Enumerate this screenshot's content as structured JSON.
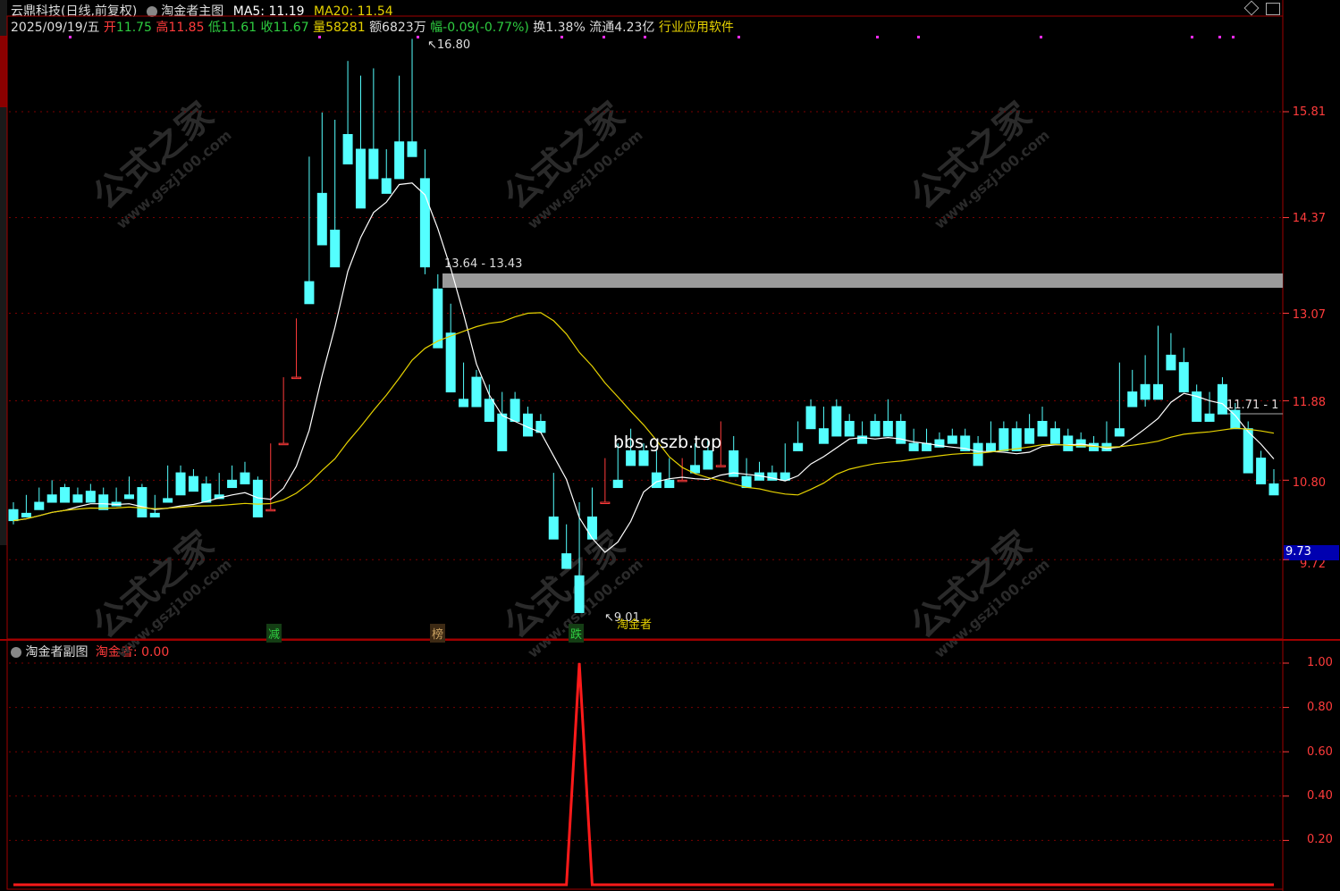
{
  "header": {
    "stock_name": "云鼎科技",
    "period_info": "(日线,前复权)",
    "indicator_name": "淘金者主图",
    "ma5_label": "MA5: 11.19",
    "ma20_label": "MA20: 11.54",
    "date": "2025/09/19/五",
    "open_label": "开",
    "open_val": "11.75",
    "high_label": "高",
    "high_val": "11.85",
    "low_label": "低",
    "low_val": "11.61",
    "close_label": "收",
    "close_val": "11.67",
    "volume_label": "量",
    "volume_val": "58281",
    "amount_label": "额6823万",
    "change_label": "幅",
    "change_val": "-0.09(-0.77%)",
    "turnover_label": "换1.38%",
    "float_label": "流通4.23亿",
    "industry": "行业应用软件"
  },
  "main_chart": {
    "y_ticks": [
      "15.81",
      "14.37",
      "13.07",
      "11.88",
      "10.80",
      "9.72"
    ],
    "current_price_tag": "9.73",
    "high_marker": "16.80",
    "low_marker": "9.01",
    "resistance_label": "13.64 - 13.43",
    "right_band_label": "11.71 - 1",
    "watermark_site": "bbs.gszb.top",
    "watermark_brand": "公式之家",
    "watermark_url": "www.gszj100.com",
    "low_tag": "淘金者",
    "signals": [
      {
        "text": "减",
        "color": "#2ecc40"
      },
      {
        "text": "榜",
        "color": "#c8a060"
      },
      {
        "text": "跌",
        "color": "#2ecc40"
      }
    ],
    "colors": {
      "up": "#ff3b3b",
      "down": "#54ffff",
      "ma5": "#ffffff",
      "ma20": "#e6d200"
    }
  },
  "sub_chart": {
    "title": "淘金者副图",
    "series_label": "淘金者:",
    "series_value": "0.00",
    "y_ticks": [
      "1.00",
      "0.80",
      "0.60",
      "0.40",
      "0.20"
    ]
  },
  "chart_data": {
    "type": "candlestick",
    "candles": [
      [
        10.4,
        10.5,
        10.25,
        10.2
      ],
      [
        10.35,
        10.6,
        10.3,
        10.5
      ],
      [
        10.5,
        10.7,
        10.4,
        10.6
      ],
      [
        10.6,
        10.8,
        10.5,
        10.75
      ],
      [
        10.7,
        10.75,
        10.5,
        10.6
      ],
      [
        10.6,
        10.7,
        10.5,
        10.65
      ],
      [
        10.65,
        10.75,
        10.5,
        10.6
      ],
      [
        10.6,
        10.7,
        10.4,
        10.5
      ],
      [
        10.5,
        10.7,
        10.45,
        10.6
      ],
      [
        10.6,
        10.85,
        10.55,
        10.7
      ],
      [
        10.7,
        10.75,
        10.3,
        10.35
      ],
      [
        10.35,
        10.6,
        10.3,
        10.55
      ],
      [
        10.55,
        11.0,
        10.5,
        10.95
      ],
      [
        10.9,
        11.0,
        10.6,
        10.85
      ],
      [
        10.85,
        10.95,
        10.65,
        10.75
      ],
      [
        10.75,
        10.85,
        10.5,
        10.6
      ],
      [
        10.6,
        10.9,
        10.55,
        10.8
      ],
      [
        10.8,
        11.0,
        10.7,
        10.9
      ],
      [
        10.9,
        11.05,
        10.75,
        10.8
      ],
      [
        10.8,
        10.85,
        10.3,
        10.35
      ],
      [
        10.4,
        11.3,
        10.4,
        11.25
      ],
      [
        11.3,
        12.2,
        11.3,
        12.1
      ],
      [
        12.2,
        13.0,
        12.2,
        13.0
      ],
      [
        13.5,
        15.2,
        13.2,
        15.0
      ],
      [
        14.7,
        15.8,
        14.0,
        14.2
      ],
      [
        14.2,
        15.7,
        13.7,
        15.0
      ],
      [
        15.5,
        16.5,
        15.1,
        15.2
      ],
      [
        15.3,
        16.3,
        14.5,
        15.4
      ],
      [
        15.3,
        16.4,
        14.9,
        15.3
      ],
      [
        14.9,
        15.3,
        14.7,
        14.7
      ],
      [
        15.4,
        16.3,
        14.9,
        15.0
      ],
      [
        15.4,
        16.8,
        15.2,
        15.5
      ],
      [
        14.9,
        15.3,
        13.7,
        13.6
      ],
      [
        13.4,
        13.6,
        12.6,
        12.8
      ],
      [
        12.8,
        13.2,
        12.0,
        12.3
      ],
      [
        11.9,
        12.4,
        11.8,
        12.2
      ],
      [
        12.2,
        12.3,
        11.8,
        12.1
      ],
      [
        11.9,
        12.1,
        11.6,
        11.7
      ],
      [
        11.7,
        12.0,
        11.2,
        11.9
      ],
      [
        11.9,
        12.0,
        11.6,
        11.75
      ],
      [
        11.7,
        11.8,
        11.4,
        11.6
      ],
      [
        11.6,
        11.7,
        11.45,
        11.5
      ],
      [
        10.3,
        10.9,
        10.0,
        10.1
      ],
      [
        9.8,
        10.2,
        9.6,
        9.8
      ],
      [
        9.5,
        10.5,
        9.0,
        10.4
      ],
      [
        10.3,
        10.7,
        10.0,
        10.5
      ],
      [
        10.5,
        11.1,
        10.5,
        10.8
      ],
      [
        10.8,
        11.3,
        10.7,
        11.0
      ],
      [
        11.2,
        11.5,
        11.0,
        11.1
      ],
      [
        11.2,
        11.3,
        11.0,
        11.1
      ],
      [
        10.9,
        11.2,
        10.7,
        11.0
      ],
      [
        10.8,
        11.1,
        10.7,
        10.9
      ],
      [
        10.8,
        11.1,
        10.8,
        10.95
      ],
      [
        11.0,
        11.3,
        10.9,
        11.2
      ],
      [
        11.2,
        11.35,
        10.95,
        11.1
      ],
      [
        11.0,
        11.6,
        11.0,
        11.5
      ],
      [
        11.2,
        11.4,
        10.85,
        10.9
      ],
      [
        10.85,
        11.1,
        10.7,
        10.95
      ],
      [
        10.9,
        11.05,
        10.8,
        10.95
      ],
      [
        10.9,
        11.0,
        10.8,
        10.85
      ],
      [
        10.9,
        11.3,
        10.8,
        11.2
      ],
      [
        11.3,
        11.6,
        11.2,
        11.5
      ],
      [
        11.8,
        11.9,
        11.5,
        11.55
      ],
      [
        11.5,
        11.8,
        11.3,
        11.75
      ],
      [
        11.8,
        11.9,
        11.4,
        11.45
      ],
      [
        11.6,
        11.7,
        11.4,
        11.5
      ],
      [
        11.4,
        11.6,
        11.3,
        11.5
      ],
      [
        11.6,
        11.7,
        11.4,
        11.45
      ],
      [
        11.6,
        11.9,
        11.4,
        11.55
      ],
      [
        11.6,
        11.7,
        11.3,
        11.3
      ],
      [
        11.3,
        11.5,
        11.2,
        11.35
      ],
      [
        11.3,
        11.5,
        11.2,
        11.4
      ],
      [
        11.35,
        11.45,
        11.25,
        11.4
      ],
      [
        11.4,
        11.5,
        11.3,
        11.35
      ],
      [
        11.4,
        11.5,
        11.2,
        11.25
      ],
      [
        11.3,
        11.4,
        11.0,
        11.1
      ],
      [
        11.3,
        11.6,
        11.2,
        11.5
      ],
      [
        11.5,
        11.6,
        11.2,
        11.3
      ],
      [
        11.5,
        11.6,
        11.2,
        11.3
      ],
      [
        11.5,
        11.7,
        11.3,
        11.6
      ],
      [
        11.6,
        11.8,
        11.4,
        11.7
      ],
      [
        11.5,
        11.6,
        11.3,
        11.35
      ],
      [
        11.4,
        11.5,
        11.2,
        11.3
      ],
      [
        11.35,
        11.45,
        11.25,
        11.3
      ],
      [
        11.3,
        11.4,
        11.2,
        11.3
      ],
      [
        11.3,
        11.6,
        11.2,
        11.5
      ],
      [
        11.5,
        12.4,
        11.4,
        12.3
      ],
      [
        12.0,
        12.3,
        11.8,
        12.1
      ],
      [
        12.1,
        12.5,
        11.9,
        11.8
      ],
      [
        12.1,
        12.9,
        11.9,
        12.6
      ],
      [
        12.5,
        12.8,
        12.3,
        12.6
      ],
      [
        12.4,
        12.6,
        12.0,
        12.0
      ],
      [
        12.0,
        12.1,
        11.6,
        11.7
      ],
      [
        11.7,
        12.0,
        11.6,
        11.95
      ],
      [
        12.1,
        12.2,
        11.7,
        11.75
      ],
      [
        11.75,
        11.85,
        11.5,
        11.5
      ],
      [
        11.5,
        11.6,
        10.9,
        10.95
      ],
      [
        11.1,
        11.2,
        10.75,
        10.8
      ],
      [
        10.75,
        10.95,
        10.6,
        10.9
      ]
    ],
    "ma5_label": "MA5: 11.19",
    "ma20_label": "MA20: 11.54",
    "sub_series": {
      "name": "淘金者",
      "spike_index": 44,
      "value": 1.0
    }
  }
}
